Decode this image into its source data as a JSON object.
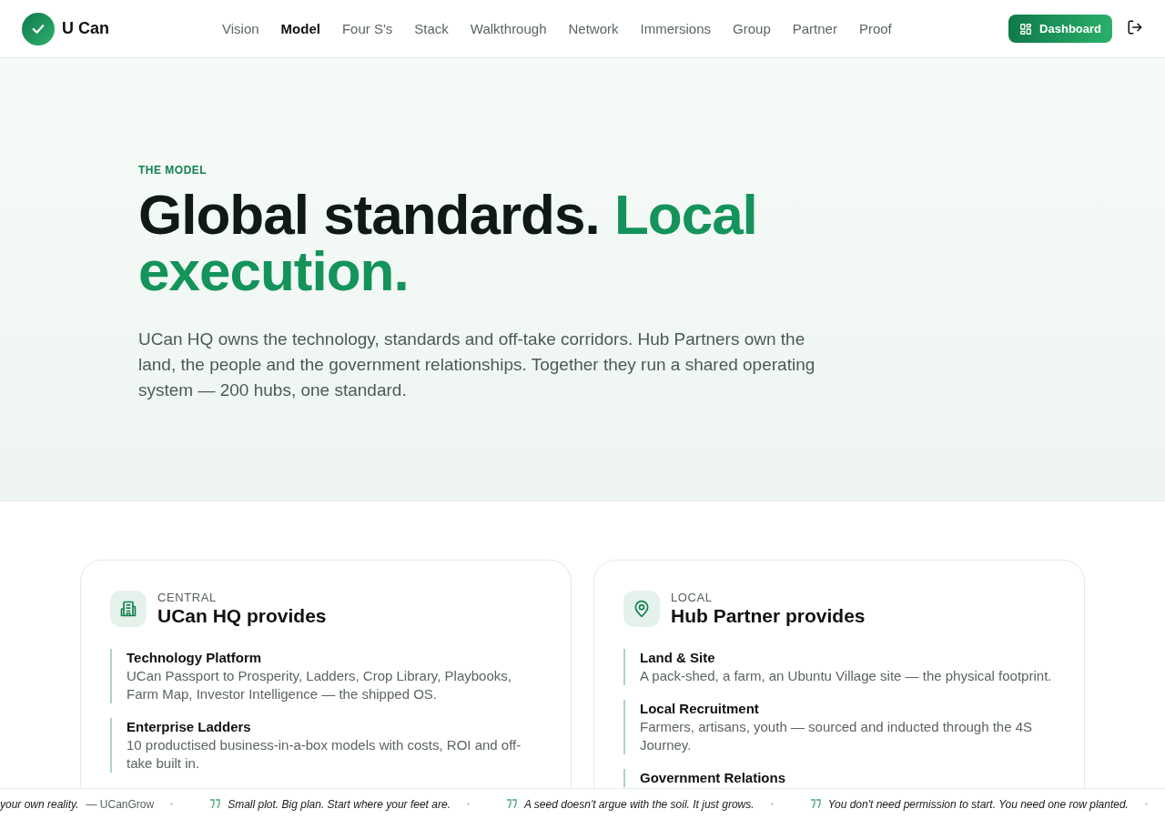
{
  "header": {
    "brand": "U Can",
    "nav": [
      {
        "label": "Vision",
        "selected": false
      },
      {
        "label": "Model",
        "selected": true
      },
      {
        "label": "Four S's",
        "selected": false
      },
      {
        "label": "Stack",
        "selected": false
      },
      {
        "label": "Walkthrough",
        "selected": false
      },
      {
        "label": "Network",
        "selected": false
      },
      {
        "label": "Immersions",
        "selected": false
      },
      {
        "label": "Group",
        "selected": false
      },
      {
        "label": "Partner",
        "selected": false
      },
      {
        "label": "Proof",
        "selected": false
      }
    ],
    "dashboard_button": "Dashboard"
  },
  "hero": {
    "eyebrow": "THE MODEL",
    "title_dark": "Global standards.",
    "title_accent": "Local execution.",
    "body": "UCan HQ owns the technology, standards and off-take corridors. Hub Partners own the land, the people and the government relationships. Together they run a shared operating system — 200 hubs, one standard."
  },
  "cards": [
    {
      "eyebrow": "CENTRAL",
      "title": "UCan HQ provides",
      "items": [
        {
          "title": "Technology Platform",
          "text": "UCan Passport to Prosperity, Ladders, Crop Library, Playbooks, Farm Map, Investor Intelligence — the shipped OS."
        },
        {
          "title": "Enterprise Ladders",
          "text": "10 productised business-in-a-box models with costs, ROI and off-take built in."
        }
      ]
    },
    {
      "eyebrow": "LOCAL",
      "title": "Hub Partner provides",
      "items": [
        {
          "title": "Land & Site",
          "text": "A pack-shed, a farm, an Ubuntu Village site — the physical footprint."
        },
        {
          "title": "Local Recruitment",
          "text": "Farmers, artisans, youth — sourced and inducted through the 4S Journey."
        },
        {
          "title": "Government Relations"
        }
      ]
    }
  ],
  "ticker": [
    {
      "kind": "tail",
      "quote": "your own reality.",
      "author": "— UCanGrow"
    },
    {
      "kind": "quote",
      "quote": "Small plot. Big plan. Start where your feet are."
    },
    {
      "kind": "quote",
      "quote": "A seed doesn't argue with the soil. It just grows."
    },
    {
      "kind": "quote",
      "quote": "You don't need permission to start. You need one row planted."
    }
  ]
}
